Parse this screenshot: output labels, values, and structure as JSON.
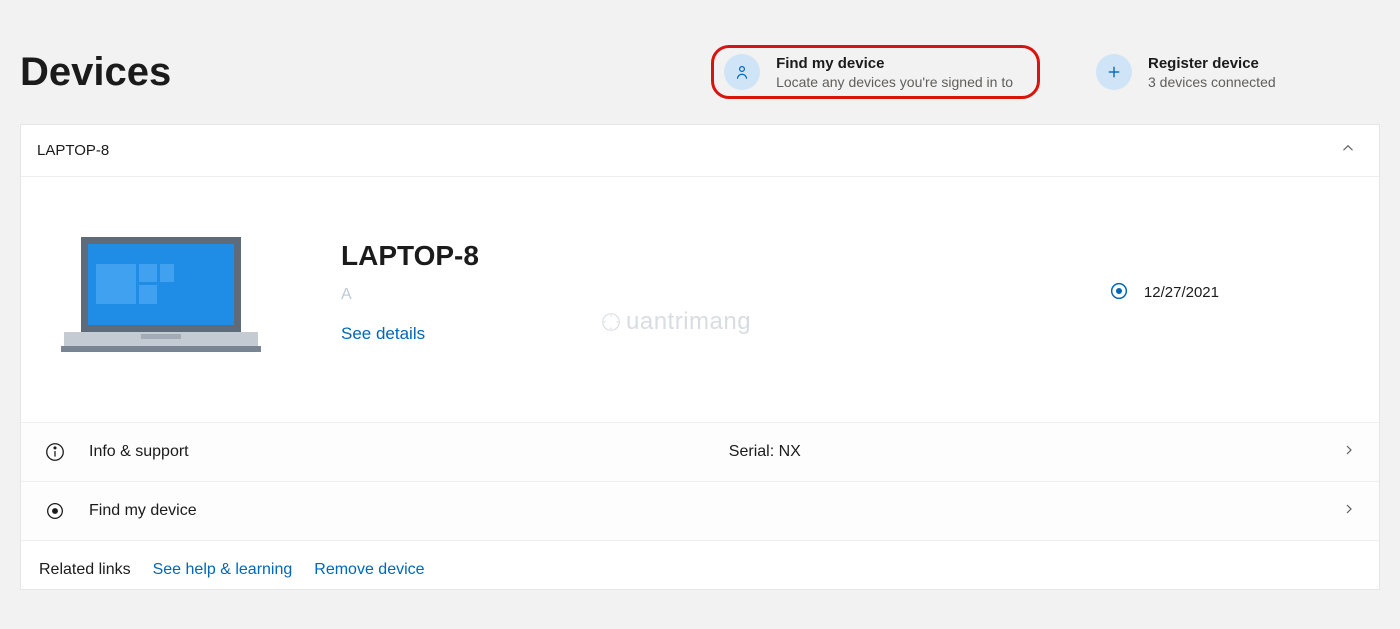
{
  "header": {
    "title": "Devices",
    "findMyDevice": {
      "title": "Find my device",
      "subtitle": "Locate any devices you're signed in to"
    },
    "registerDevice": {
      "title": "Register device",
      "subtitle": "3 devices connected"
    }
  },
  "deviceCard": {
    "headerLabel": "LAPTOP-8",
    "deviceName": "LAPTOP-8",
    "deviceSub": "A",
    "seeDetails": "See details",
    "locationLine1": "",
    "locationDate": "12/27/2021"
  },
  "rows": {
    "info": {
      "label": "Info & support",
      "serial": "Serial: NX"
    },
    "find": {
      "label": "Find my device"
    }
  },
  "footer": {
    "relatedLinks": "Related links",
    "help": "See help & learning",
    "remove": "Remove device"
  },
  "watermark": "uantrimang"
}
